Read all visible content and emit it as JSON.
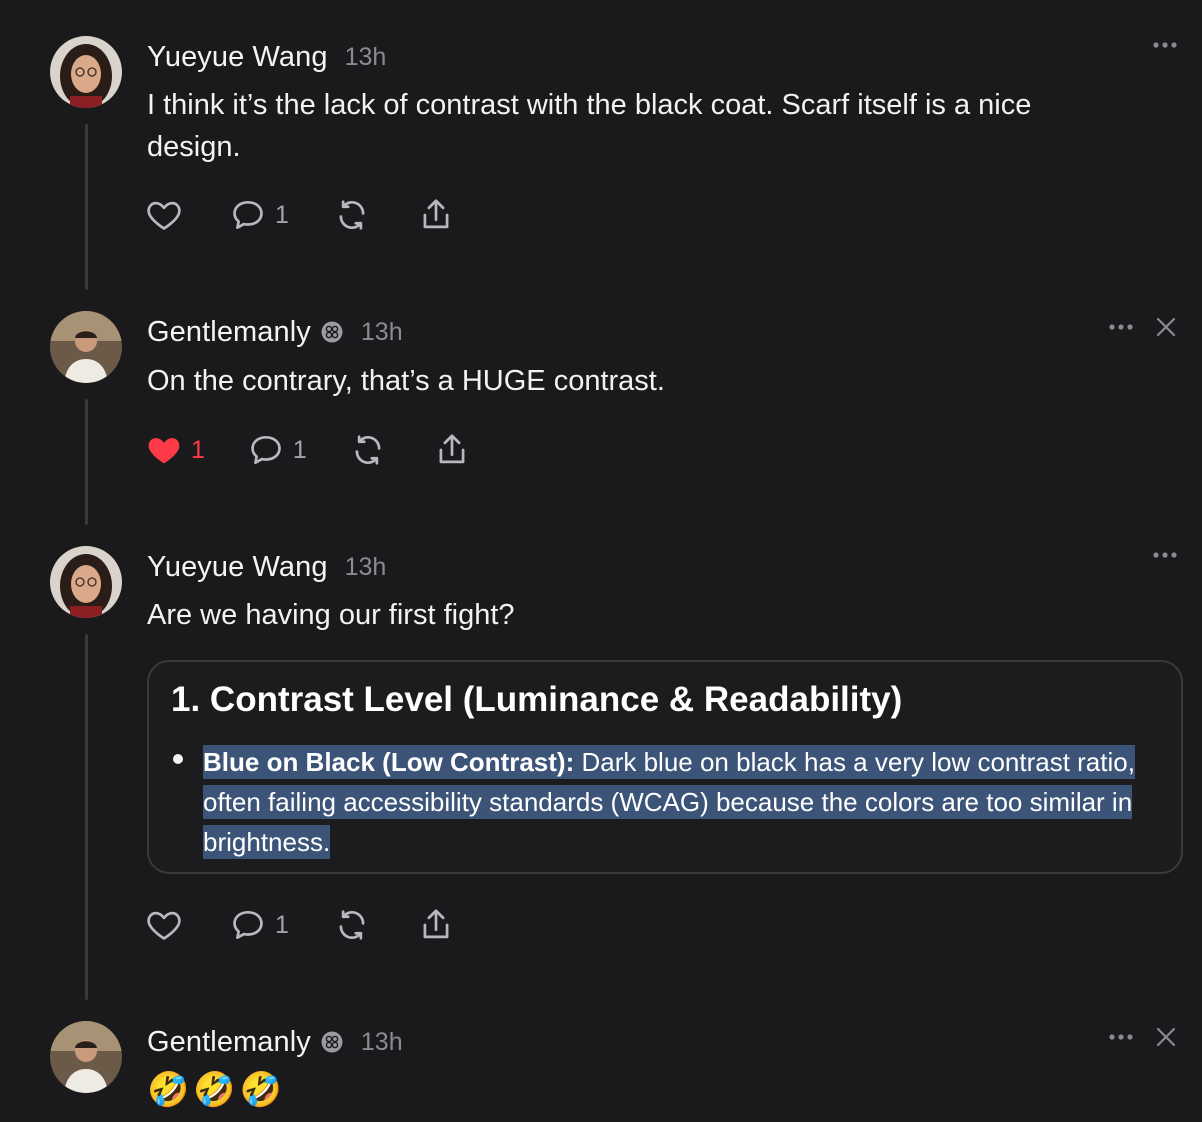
{
  "posts": [
    {
      "author": "Yueyue Wang",
      "time": "13h",
      "text": "I think it’s the lack of contrast with the black coat. Scarf itself is a nice design.",
      "likes": "",
      "replies": "1",
      "liked": false
    },
    {
      "author": "Gentlemanly",
      "time": "13h",
      "text": "On the contrary, that’s a HUGE contrast.",
      "likes": "1",
      "replies": "1",
      "liked": true
    },
    {
      "author": "Yueyue Wang",
      "time": "13h",
      "text": "Are we having our first fight?",
      "likes": "",
      "replies": "1",
      "liked": false,
      "quote": {
        "title": "1. Contrast Level (Luminance & Readability)",
        "bullet_bold": "Blue on Black (Low Contrast):",
        "bullet_text": " Dark blue on black has a very low contrast ratio, often failing accessibility standards (WCAG) because the colors are too similar in brightness."
      }
    },
    {
      "author": "Gentlemanly",
      "time": "13h",
      "text": "",
      "emojis": [
        "🤣",
        "🤣",
        "🤣"
      ]
    }
  ],
  "colors": {
    "background": "#1a1a1c",
    "liked_heart": "#ff3b49",
    "selection_highlight": "#3c5478",
    "thread_line": "#3a3a3d"
  },
  "icons": {
    "like": "heart-icon",
    "reply": "speech-bubble-icon",
    "repost": "repost-icon",
    "share": "share-icon",
    "more": "more-dots-icon",
    "dismiss": "close-icon",
    "badge": "verified-badge-icon"
  }
}
